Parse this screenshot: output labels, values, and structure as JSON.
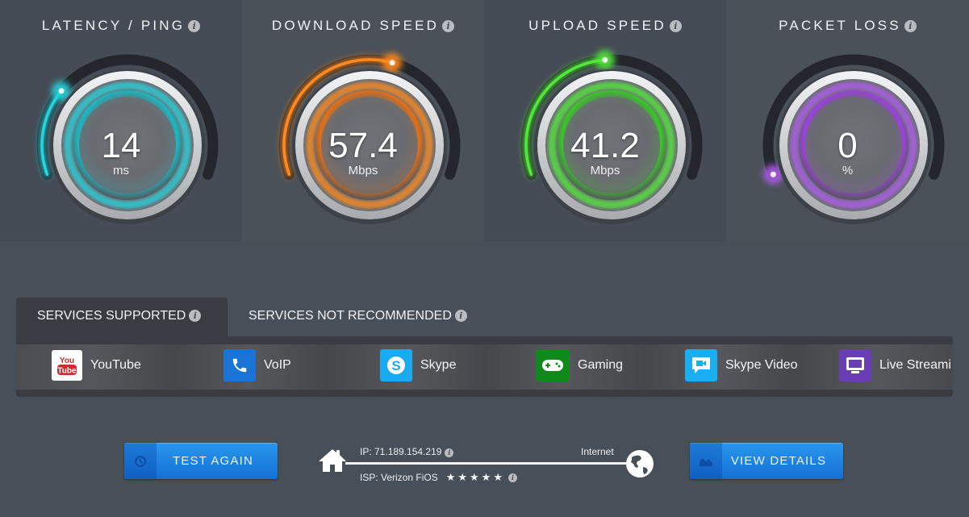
{
  "gauges": [
    {
      "title": "LATENCY / PING",
      "value": "14",
      "unit": "ms",
      "fill": 0.27,
      "color": "#27d3dc",
      "glow": "#1fb6c0"
    },
    {
      "title": "DOWNLOAD SPEED",
      "value": "57.4",
      "unit": "Mbps",
      "fill": 0.57,
      "color": "#ff8a1f",
      "glow": "#e0701a"
    },
    {
      "title": "UPLOAD SPEED",
      "value": "41.2",
      "unit": "Mbps",
      "fill": 0.48,
      "color": "#52e83a",
      "glow": "#3cc42c"
    },
    {
      "title": "PACKET LOSS",
      "value": "0",
      "unit": "%",
      "fill": 0.0,
      "color": "#b05cf0",
      "glow": "#9a44d8"
    }
  ],
  "services": {
    "tabs": [
      {
        "label": "SERVICES SUPPORTED",
        "active": true
      },
      {
        "label": "SERVICES NOT RECOMMENDED",
        "active": false
      }
    ],
    "items": [
      {
        "label": "YouTube",
        "icon": "youtube-icon",
        "bg": "#ffffff"
      },
      {
        "label": "VoIP",
        "icon": "phone-icon",
        "bg": "#1a73d6"
      },
      {
        "label": "Skype",
        "icon": "skype-icon",
        "bg": "#1aaaf0"
      },
      {
        "label": "Gaming",
        "icon": "gamepad-icon",
        "bg": "#11891a"
      },
      {
        "label": "Skype Video",
        "icon": "video-chat-icon",
        "bg": "#19aef0"
      },
      {
        "label": "Live Streami",
        "icon": "monitor-icon",
        "bg": "#6a3db4"
      }
    ]
  },
  "actions": {
    "test_again": "TEST AGAIN",
    "view_details": "VIEW DETAILS"
  },
  "connection": {
    "ip": "IP: 71.189.154.219",
    "isp": "ISP: Verizon FiOS",
    "internet": "Internet",
    "isp_rating": 5,
    "isp_rating_max": 5
  }
}
